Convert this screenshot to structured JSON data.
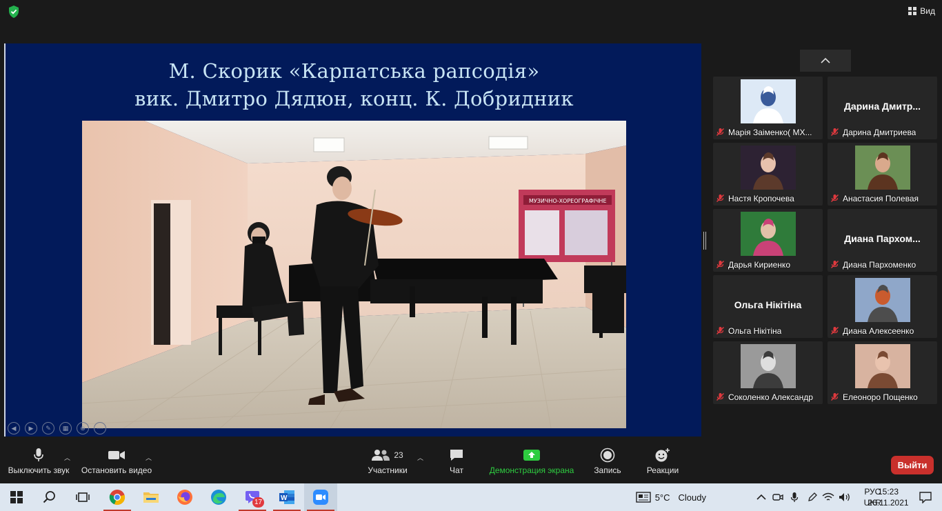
{
  "window": {
    "view_label": "Вид"
  },
  "share": {
    "title_line1": "М. Скорик «Карпатська рапсодія»",
    "title_line2": "вик. Дмитро Дядюн, конц. К. Добридник",
    "photo_banner": "МУЗИЧНО-ХОРЕОГРАФІЧНЕ"
  },
  "participants": [
    {
      "name": "Марія Заіменко( МХ...",
      "big_name": "",
      "has_video": true
    },
    {
      "name": "Дарина Дмитриева",
      "big_name": "Дарина  Дмитр...",
      "has_video": false
    },
    {
      "name": "Настя Кропочева",
      "big_name": "",
      "has_video": true
    },
    {
      "name": "Анастасия Полевая",
      "big_name": "",
      "has_video": true
    },
    {
      "name": "Дарья Кириенко",
      "big_name": "",
      "has_video": true
    },
    {
      "name": "Диана Пархоменко",
      "big_name": "Диана  Пархом...",
      "has_video": false
    },
    {
      "name": "Ольга Нікітіна",
      "big_name": "Ольга Нікітіна",
      "has_video": false
    },
    {
      "name": "Диана Алексеенко",
      "big_name": "",
      "has_video": true
    },
    {
      "name": "Соколенко Александр",
      "big_name": "",
      "has_video": true
    },
    {
      "name": "Елеоноро Пощенко",
      "big_name": "",
      "has_video": true
    }
  ],
  "controls": {
    "mute_label": "Выключить звук",
    "video_label": "Остановить видео",
    "participants_label": "Участники",
    "participants_count": "23",
    "chat_label": "Чат",
    "share_label": "Демонстрация экрана",
    "record_label": "Запись",
    "reactions_label": "Реакции",
    "leave_label": "Выйти"
  },
  "taskbar": {
    "purple_app_badge": "17",
    "weather_temp": "5°C",
    "weather_desc": "Cloudy",
    "lang_top": "РУС",
    "lang_bottom": "UKR",
    "time": "15:23",
    "date": "26.11.2021"
  },
  "colors": {
    "slide_bg": "#021a5a",
    "share_green": "#2ecc40",
    "leave_red": "#c9302c",
    "muted_red": "#e0393e"
  }
}
